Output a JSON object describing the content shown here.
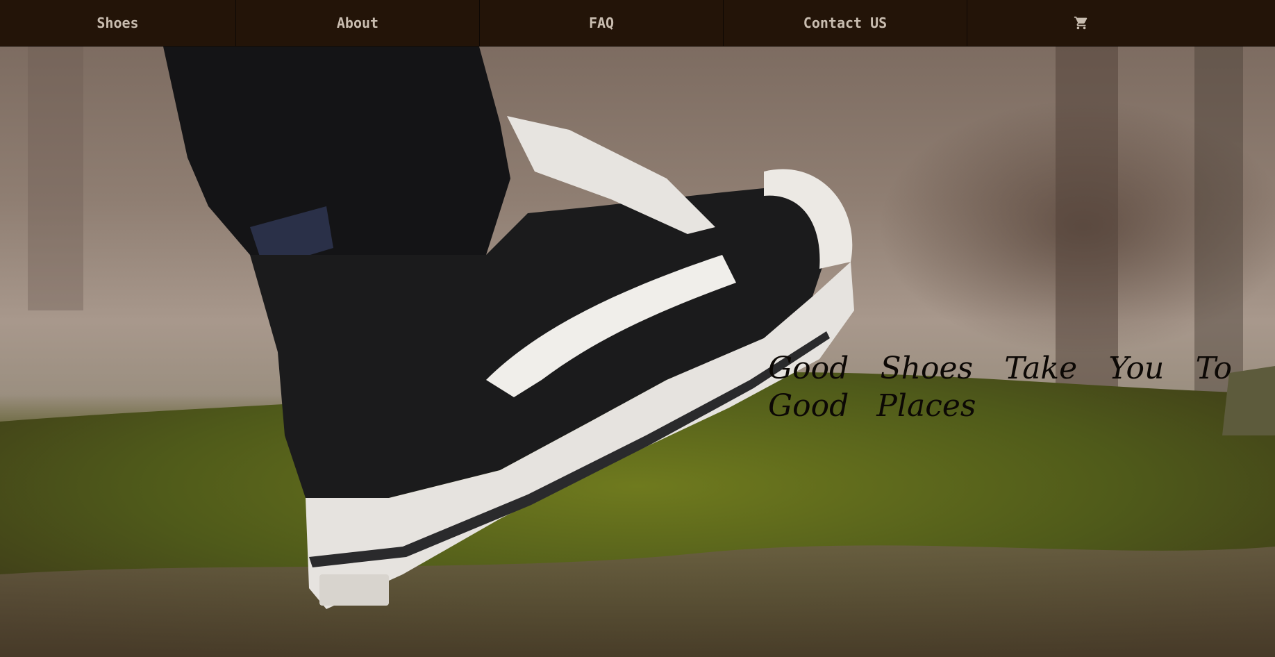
{
  "nav": {
    "items": [
      {
        "label": "Shoes"
      },
      {
        "label": "About"
      },
      {
        "label": "FAQ"
      },
      {
        "label": "Contact US"
      }
    ],
    "cart_icon": "shopping-cart-icon"
  },
  "hero": {
    "tagline": "Good Shoes Take You To Good Places"
  },
  "colors": {
    "navbar_bg": "#231408",
    "nav_text": "#c9bdb0",
    "tagline_text": "#0c0805"
  }
}
